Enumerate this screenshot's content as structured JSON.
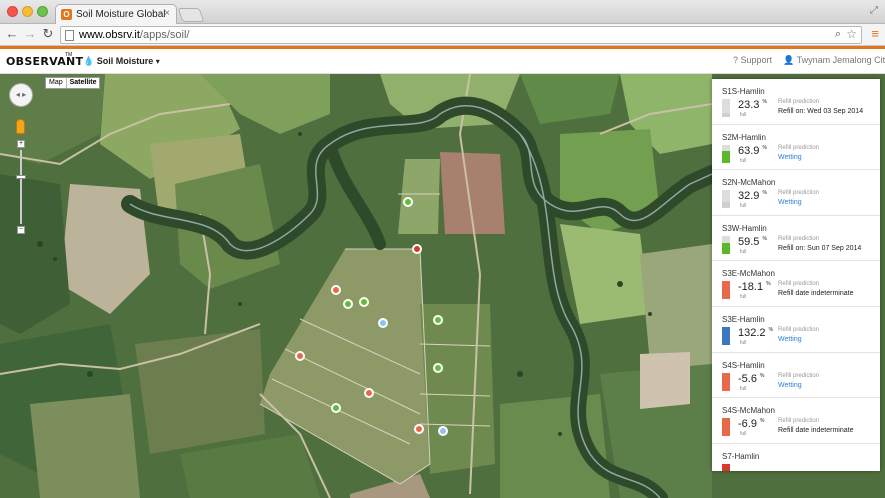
{
  "browser": {
    "tab_title": "Soil Moisture Global",
    "favicon_letter": "O",
    "tab_close": "×",
    "url_host": "www.obsrv.it",
    "url_path": "/apps/soil/",
    "back": "←",
    "forward": "→",
    "reload": "↻",
    "search_glyph": "⌕",
    "star_glyph": "☆",
    "menu_glyph": "≡",
    "resize_glyph": "⤢"
  },
  "app": {
    "logo": "OBSERVANT",
    "logo_tm": "TM",
    "menu_label": "Soil Moisture",
    "menu_caret": "▾",
    "support_label": "Support",
    "account_label": "Twynam Jemalong Citrus",
    "account_caret": "▾"
  },
  "map": {
    "type_map": "Map",
    "type_satellite": "Satellite",
    "pan_glyph": "◂ ▸",
    "zoom_in": "+",
    "zoom_out": "−",
    "zoom_level_fraction": 0.35,
    "marker_colors": {
      "green": "#5fbf2f",
      "orange": "#e8694a",
      "blue": "#8fc3ee",
      "red": "#d63a2a"
    }
  },
  "sites": [
    {
      "name": "S1S-Hamlin",
      "value": "23.3",
      "unit": "%",
      "full_label": "full",
      "fill_fraction": 0.23,
      "color": "#cfcfcf",
      "pred_label": "Refill prediction",
      "pred": "Refill on: Wed 03 Sep 2014",
      "pred_link": false
    },
    {
      "name": "S2M-Hamlin",
      "value": "63.9",
      "unit": "%",
      "full_label": "full",
      "fill_fraction": 0.64,
      "color": "#5ab82a",
      "pred_label": "Refill prediction",
      "pred": "Wetting",
      "pred_link": true
    },
    {
      "name": "S2N-McMahon",
      "value": "32.9",
      "unit": "%",
      "full_label": "full",
      "fill_fraction": 0.33,
      "color": "#cfcfcf",
      "pred_label": "Refill prediction",
      "pred": "Wetting",
      "pred_link": true
    },
    {
      "name": "S3W-Hamlin",
      "value": "59.5",
      "unit": "%",
      "full_label": "full",
      "fill_fraction": 0.6,
      "color": "#5ab82a",
      "pred_label": "Refill prediction",
      "pred": "Refill on: Sun 07 Sep 2014",
      "pred_link": false
    },
    {
      "name": "S3E-McMahon",
      "value": "-18.1",
      "unit": "%",
      "full_label": "full",
      "fill_fraction": 1.0,
      "color": "#e8694a",
      "pred_label": "Refill prediction",
      "pred": "Refill date indeterminate",
      "pred_link": false
    },
    {
      "name": "S3E-Hamlin",
      "value": "132.2",
      "unit": "%",
      "full_label": "full",
      "fill_fraction": 1.0,
      "color": "#3a78c2",
      "pred_label": "Refill prediction",
      "pred": "Wetting",
      "pred_link": true
    },
    {
      "name": "S4S-Hamlin",
      "value": "-5.6",
      "unit": "%",
      "full_label": "full",
      "fill_fraction": 1.0,
      "color": "#e8694a",
      "pred_label": "Refill prediction",
      "pred": "Wetting",
      "pred_link": true
    },
    {
      "name": "S4S-McMahon",
      "value": "-6.9",
      "unit": "%",
      "full_label": "full",
      "fill_fraction": 1.0,
      "color": "#e8694a",
      "pred_label": "Refill prediction",
      "pred": "Refill date indeterminate",
      "pred_link": false
    },
    {
      "name": "S7-Hamlin",
      "value": "",
      "unit": "",
      "full_label": "",
      "fill_fraction": 1.0,
      "color": "#d63a2a",
      "pred_label": "",
      "pred": "",
      "pred_link": false
    }
  ]
}
